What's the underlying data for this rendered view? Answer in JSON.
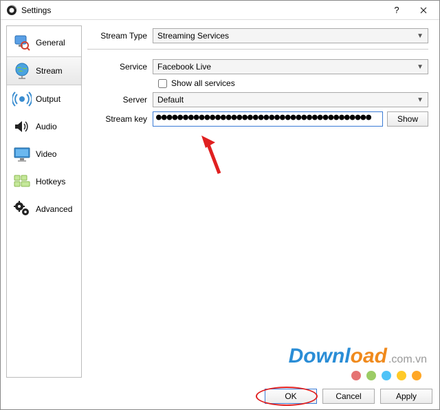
{
  "window": {
    "title": "Settings"
  },
  "sidebar": {
    "items": [
      {
        "label": "General"
      },
      {
        "label": "Stream"
      },
      {
        "label": "Output"
      },
      {
        "label": "Audio"
      },
      {
        "label": "Video"
      },
      {
        "label": "Hotkeys"
      },
      {
        "label": "Advanced"
      }
    ]
  },
  "form": {
    "stream_type_label": "Stream Type",
    "stream_type_value": "Streaming Services",
    "service_label": "Service",
    "service_value": "Facebook Live",
    "show_all_label": "Show all services",
    "show_all_checked": false,
    "server_label": "Server",
    "server_value": "Default",
    "stream_key_label": "Stream key",
    "stream_key_value": "●●●●●●●●●●●●●●●●●●●●●●●●●●●●●●●●●●●●●●●●",
    "show_button": "Show"
  },
  "footer": {
    "ok": "OK",
    "cancel": "Cancel",
    "apply": "Apply"
  },
  "watermark": {
    "text_blue": "Downl",
    "text_orange": "oad",
    "text_grey": ".com.vn",
    "dot_colors": [
      "#e57373",
      "#9ccc65",
      "#4fc3f7",
      "#ffca28",
      "#ffa726"
    ]
  }
}
